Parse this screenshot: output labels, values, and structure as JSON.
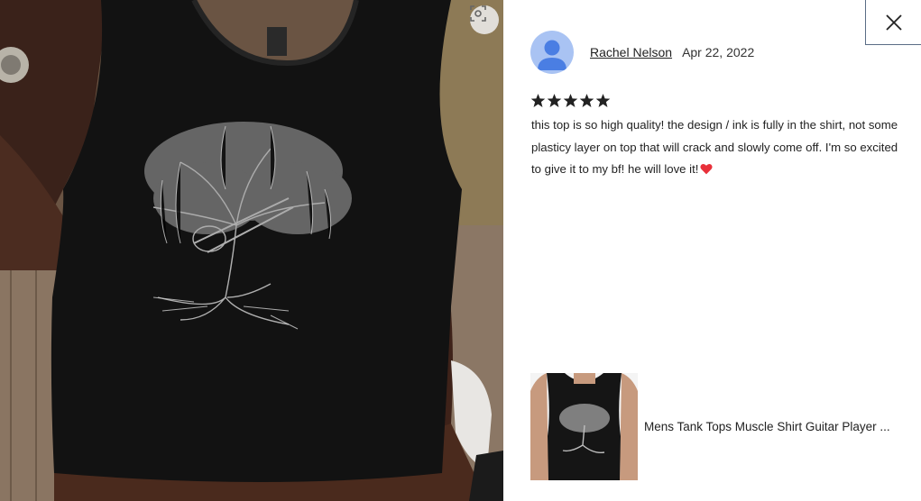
{
  "photo": {
    "alt_icon": "visual-search-icon"
  },
  "review": {
    "reviewer_name": "Rachel Nelson",
    "date": "Apr 22, 2022",
    "rating": 5,
    "rating_max": 5,
    "text": "this top is so high quality! the design / ink is fully in the shirt, not some plasticy layer on top that will crack and slowly come off. I'm so excited to give it to my bf! he will love it!",
    "emoji": "heart-icon"
  },
  "product": {
    "title": "Mens Tank Tops Muscle Shirt Guitar Player ..."
  },
  "colors": {
    "avatar_bg": "#a9c3f3",
    "avatar_fg": "#4a7ee3",
    "star": "#222222",
    "heart": "#e8303a",
    "close_border": "#5a6d86"
  },
  "icons": {
    "close": "close-icon",
    "star": "star-icon"
  }
}
